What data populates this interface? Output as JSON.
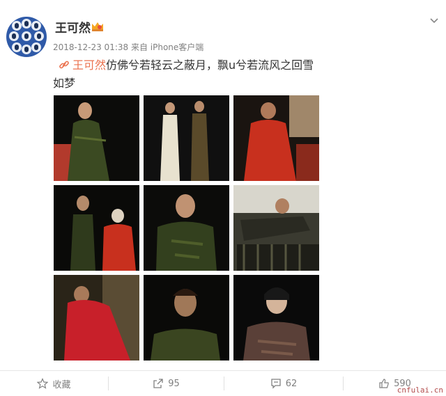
{
  "post": {
    "username": "王可然",
    "timestamp": "2018-12-23 01:38 来自 iPhone客户端",
    "mention": "王可然",
    "text_line1": "仿佛兮若轻云之蔽月，飘u兮若流风之回雪",
    "text_line2": "如梦"
  },
  "photos": [
    {
      "desc": "woman in green patterned qipao holding red cloth"
    },
    {
      "desc": "two women in qipao on stage"
    },
    {
      "desc": "woman in red dress seated"
    },
    {
      "desc": "woman in green qipao with elderly figure in red"
    },
    {
      "desc": "close-up woman in green qipao"
    },
    {
      "desc": "figure bending over balcony railing"
    },
    {
      "desc": "figures embracing in red"
    },
    {
      "desc": "woman in qipao looking down"
    },
    {
      "desc": "woman in dark patterned qipao portrait"
    }
  ],
  "actions": {
    "favorite_label": "收藏",
    "repost_count": "95",
    "comment_count": "62",
    "like_count": "590"
  },
  "watermark": "cnfulai.cn",
  "colors": {
    "mention": "#eb7350",
    "meta": "#808080",
    "accent": "#eb7350"
  },
  "icons": [
    "avatar",
    "vip-badge-icon",
    "chevron-down-icon",
    "link-icon",
    "star-icon",
    "repost-icon",
    "comment-icon",
    "like-icon"
  ]
}
